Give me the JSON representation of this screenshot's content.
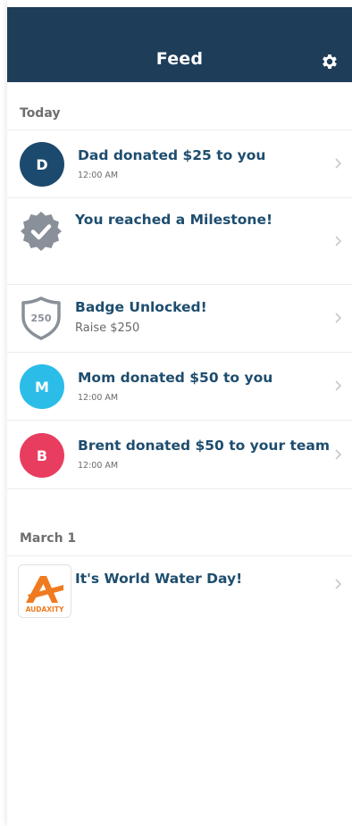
{
  "header": {
    "title": "Feed",
    "bg_color": "#1e3d59",
    "settings_icon": "gear-icon"
  },
  "sections": [
    {
      "label": "Today"
    },
    {
      "label": "March 1"
    }
  ],
  "today_items": [
    {
      "type": "donation",
      "avatar_letter": "D",
      "avatar_color": "#1b4a6e",
      "title": "Dad donated $25 to you",
      "time": "12:00 AM"
    },
    {
      "type": "milestone",
      "icon": "milestone-check-icon",
      "title": "You reached a Milestone!"
    },
    {
      "type": "badge",
      "icon": "shield-badge-icon",
      "badge_value": "250",
      "title": "Badge Unlocked!",
      "subtitle": "Raise $250"
    },
    {
      "type": "donation",
      "avatar_letter": "M",
      "avatar_color": "#2bbde8",
      "title": "Mom donated $50 to you",
      "time": "12:00 AM"
    },
    {
      "type": "donation",
      "avatar_letter": "B",
      "avatar_color": "#e83d5f",
      "title": "Brent donated $50 to your team",
      "time": "12:00 AM"
    }
  ],
  "march_items": [
    {
      "type": "event",
      "logo_text": "AUDAXITY",
      "logo_color": "#f07a1f",
      "title": "It's World Water Day!"
    }
  ]
}
